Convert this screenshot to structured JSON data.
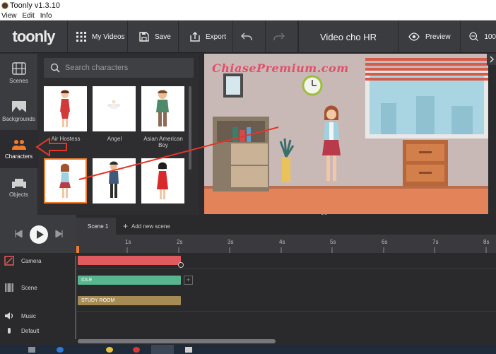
{
  "window": {
    "title": "Toonly v1.3.10"
  },
  "menu": [
    "View",
    "Edit",
    "Info"
  ],
  "toolbar": {
    "logo": "toonly",
    "my_videos": "My Videos",
    "save": "Save",
    "export": "Export",
    "document_title": "Video cho HR",
    "preview": "Preview",
    "zoom": "100"
  },
  "nav": [
    {
      "label": "Scenes",
      "icon": "scenes-icon"
    },
    {
      "label": "Backgrounds",
      "icon": "backgrounds-icon"
    },
    {
      "label": "Characters",
      "icon": "characters-icon"
    },
    {
      "label": "Objects",
      "icon": "objects-icon"
    }
  ],
  "panel": {
    "search_placeholder": "Search characters",
    "items": [
      {
        "label": "Air Hostess"
      },
      {
        "label": "Angel"
      },
      {
        "label": "Asian American\nBoy"
      },
      {
        "label": ""
      },
      {
        "label": ""
      },
      {
        "label": ""
      }
    ]
  },
  "watermark": "ChiasePremium.com",
  "timeline": {
    "scene_tab": "Scene 1",
    "add_scene": "Add new scene",
    "ticks": [
      "1s",
      "2s",
      "3s",
      "4s",
      "5s",
      "6s",
      "7s",
      "8s"
    ],
    "tracks": [
      {
        "label": "Camera"
      },
      {
        "label": "Scene"
      },
      {
        "label": "Music"
      },
      {
        "label": "Default"
      }
    ],
    "bars": {
      "idle": "IDLE",
      "room": "STUDY ROOM"
    }
  },
  "colors": {
    "accent": "#f07b2a",
    "camera_bar": "#e05a5e",
    "idle_bar": "#59b58e",
    "room_bar": "#a68b55"
  }
}
